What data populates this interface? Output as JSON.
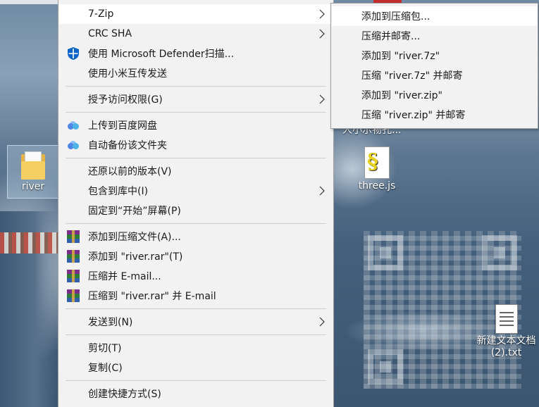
{
  "desktop": {
    "icons": [
      {
        "label": "river",
        "icon": "folder-icon"
      },
      {
        "label": "three.js",
        "icon": "js-file-icon"
      },
      {
        "label_line1": "新建文本文档",
        "label_line2": "(2).txt",
        "icon": "text-file-icon"
      }
    ],
    "partial_label": "人小示物孔..."
  },
  "context_menu": {
    "groups": [
      [
        {
          "label": "7-Zip",
          "icon": null,
          "submenu": true,
          "highlighted": true
        },
        {
          "label": "CRC SHA",
          "icon": null,
          "submenu": true
        },
        {
          "label": "使用 Microsoft Defender扫描...",
          "icon": "defender-shield-icon"
        },
        {
          "label": "使用小米互传发送",
          "icon": null
        }
      ],
      [
        {
          "label": "授予访问权限(G)",
          "icon": null,
          "submenu": true
        }
      ],
      [
        {
          "label": "上传到百度网盘",
          "icon": "baidu-cloud-icon"
        },
        {
          "label": "自动备份该文件夹",
          "icon": "baidu-cloud-icon"
        }
      ],
      [
        {
          "label": "还原以前的版本(V)",
          "icon": null
        },
        {
          "label": "包含到库中(I)",
          "icon": null,
          "submenu": true
        },
        {
          "label": "固定到“开始”屏幕(P)",
          "icon": null
        }
      ],
      [
        {
          "label": "添加到压缩文件(A)...",
          "icon": "winrar-icon"
        },
        {
          "label": "添加到 \"river.rar\"(T)",
          "icon": "winrar-icon"
        },
        {
          "label": "压缩并 E-mail...",
          "icon": "winrar-icon"
        },
        {
          "label": "压缩到 \"river.rar\" 并 E-mail",
          "icon": "winrar-icon"
        }
      ],
      [
        {
          "label": "发送到(N)",
          "icon": null,
          "submenu": true
        }
      ],
      [
        {
          "label": "剪切(T)",
          "icon": null
        },
        {
          "label": "复制(C)",
          "icon": null
        }
      ],
      [
        {
          "label": "创建快捷方式(S)",
          "icon": null
        }
      ]
    ]
  },
  "submenu_7zip": {
    "items": [
      {
        "label": "添加到压缩包...",
        "highlighted": true
      },
      {
        "label": "压缩并邮寄..."
      },
      {
        "label": "添加到 \"river.7z\""
      },
      {
        "label": "压缩 \"river.7z\" 并邮寄"
      },
      {
        "label": "添加到 \"river.zip\""
      },
      {
        "label": "压缩 \"river.zip\" 并邮寄"
      }
    ]
  },
  "colors": {
    "menu_bg": "#f2f2f2",
    "menu_highlight": "#ffffff",
    "separator": "#cfcfcf",
    "defender_blue": "#0a63c9"
  }
}
